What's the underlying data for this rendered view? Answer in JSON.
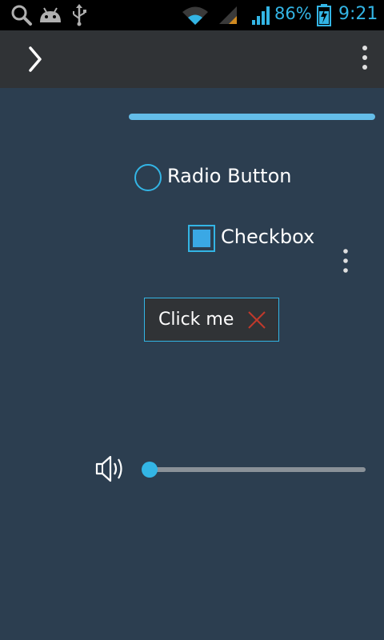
{
  "status_bar": {
    "icons": [
      "search-icon",
      "android-icon",
      "usb-icon",
      "wifi-icon",
      "signal-icon",
      "cell-signal-icon",
      "battery-charging-icon"
    ],
    "battery_percent": "86%",
    "time": "9:21"
  },
  "action_bar": {
    "icons": [
      "chevron-right-icon",
      "overflow-menu-icon"
    ]
  },
  "progress": {
    "value": 1.0
  },
  "radio": {
    "label": "Radio Button",
    "checked": false
  },
  "checkbox": {
    "label": "Checkbox",
    "checked": true
  },
  "chip": {
    "label": "Click me",
    "icon": "close-icon"
  },
  "volume": {
    "icon": "volume-icon",
    "value": 0.0
  },
  "colors": {
    "accent": "#33b5e5",
    "background": "#2c3e50",
    "close": "#c0392b"
  }
}
